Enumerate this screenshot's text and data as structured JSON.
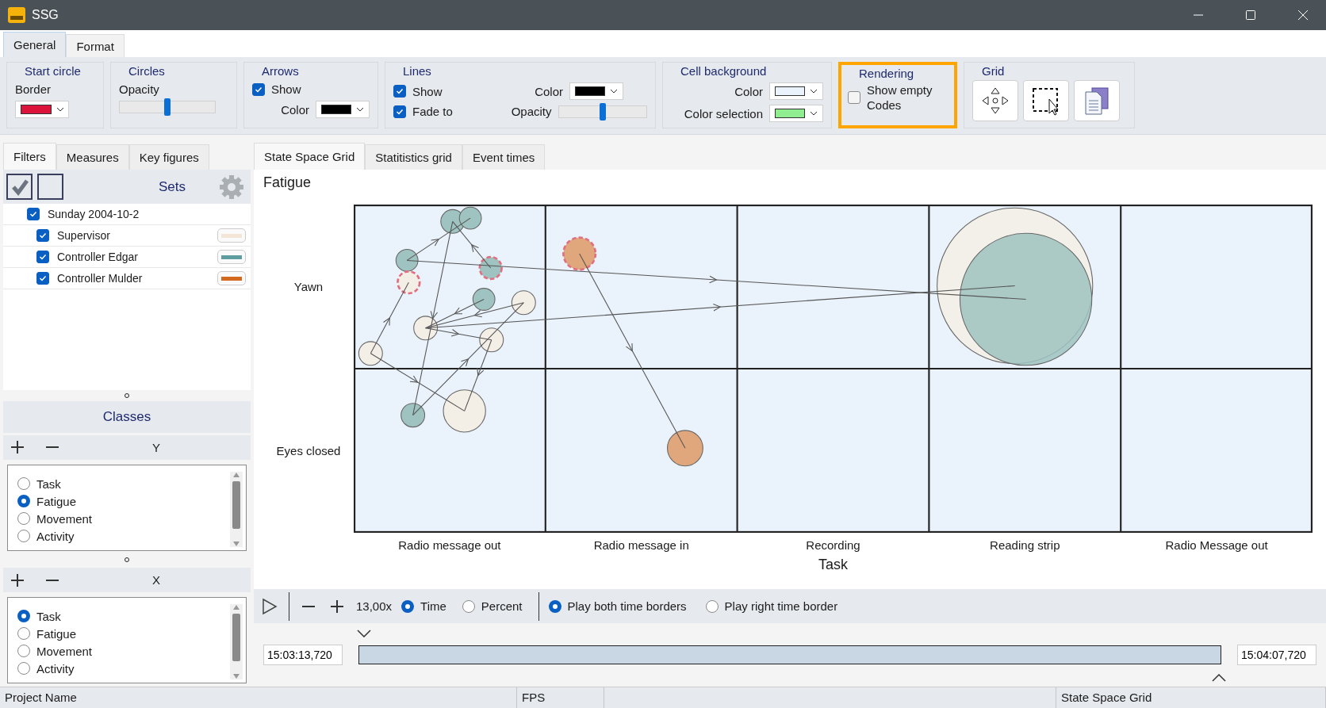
{
  "window": {
    "title": "SSG"
  },
  "ribbon_tabs": [
    {
      "label": "General",
      "selected": true
    },
    {
      "label": "Format",
      "selected": false
    }
  ],
  "ribbon": {
    "start_circle": {
      "title": "Start circle",
      "border_label": "Border"
    },
    "circles": {
      "title": "Circles",
      "opacity_label": "Opacity",
      "level": 0.5
    },
    "arrows": {
      "title": "Arrows",
      "show": {
        "label": "Show",
        "checked": true
      },
      "color_label": "Color"
    },
    "lines": {
      "title": "Lines",
      "show": {
        "label": "Show",
        "checked": true
      },
      "fade_to": {
        "label": "Fade to",
        "checked": true
      },
      "color_label": "Color",
      "opacity_label": "Opacity",
      "level": 0.5
    },
    "cell_background": {
      "title": "Cell background",
      "color_label": "Color",
      "selection_label": "Color selection"
    },
    "rendering": {
      "title": "Rendering",
      "highlighted": true,
      "show_empty": {
        "label": "Show empty Codes",
        "checked": false
      }
    },
    "grid": {
      "title": "Grid"
    }
  },
  "left_tabs": [
    {
      "label": "Filters",
      "selected": true
    },
    {
      "label": "Measures",
      "selected": false
    },
    {
      "label": "Key figures",
      "selected": false
    }
  ],
  "sets": {
    "title": "Sets",
    "tree": [
      {
        "label": "Sunday 2004-10-2",
        "checked": true,
        "children": [
          {
            "label": "Supervisor",
            "checked": true,
            "color": "#f3e6d6"
          },
          {
            "label": "Controller Edgar",
            "checked": true,
            "color": "#5f9ea0"
          },
          {
            "label": "Controller Mulder",
            "checked": true,
            "color": "#d2691e"
          }
        ]
      }
    ]
  },
  "classes": {
    "title": "Classes",
    "y_axis": {
      "label": "Y",
      "options": [
        {
          "label": "Task",
          "selected": false
        },
        {
          "label": "Fatigue",
          "selected": true
        },
        {
          "label": "Movement",
          "selected": false
        },
        {
          "label": "Activity",
          "selected": false
        }
      ]
    },
    "x_axis": {
      "label": "X",
      "options": [
        {
          "label": "Task",
          "selected": true
        },
        {
          "label": "Fatigue",
          "selected": false
        },
        {
          "label": "Movement",
          "selected": false
        },
        {
          "label": "Activity",
          "selected": false
        }
      ]
    }
  },
  "main_tabs": [
    {
      "label": "State Space Grid",
      "selected": true
    },
    {
      "label": "Statitistics grid",
      "selected": false
    },
    {
      "label": "Event times",
      "selected": false
    }
  ],
  "grid": {
    "y_title": "Fatigue",
    "x_title": "Task",
    "rows": [
      "Yawn",
      "Eyes closed"
    ],
    "columns": [
      "Radio message out",
      "Radio message in",
      "Recording",
      "Reading strip",
      "Radio Message out"
    ]
  },
  "player": {
    "zoom": "13,00x",
    "modes": [
      {
        "label": "Time",
        "selected": true
      },
      {
        "label": "Percent",
        "selected": false
      }
    ],
    "play": [
      {
        "label": "Play both time borders",
        "selected": true
      },
      {
        "label": "Play right time border",
        "selected": false
      }
    ],
    "start": "15:03:13,720",
    "end": "15:04:07,720"
  },
  "status_bar": {
    "project": "Project Name",
    "fps": "FPS",
    "view": "State Space Grid"
  }
}
